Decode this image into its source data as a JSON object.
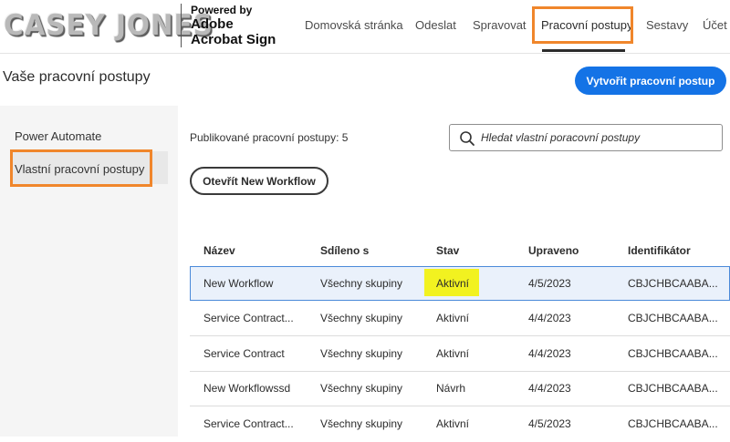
{
  "header": {
    "logo_text": "CASEY JONES",
    "powered_by": "Powered by",
    "brand_line1": "Adobe",
    "brand_line2": "Acrobat Sign",
    "nav": [
      "Domovská stránka",
      "Odeslat",
      "Spravovat",
      "Pracovní postupy",
      "Sestavy",
      "Účet"
    ],
    "active_nav": "Pracovní postupy"
  },
  "page": {
    "title": "Vaše pracovní postupy",
    "create_label": "Vytvořit pracovní postup"
  },
  "sidebar": {
    "items": [
      {
        "label": "Power Automate"
      },
      {
        "label": "Vlastní pracovní postupy"
      }
    ],
    "selected": "Vlastní pracovní postupy"
  },
  "main": {
    "count_label": "Publikované pracovní postupy: 5",
    "search_placeholder": "Hledat vlastní poracovní postupy",
    "open_button": "Otevřít New Workflow"
  },
  "table": {
    "columns": [
      "Název",
      "Sdíleno s",
      "Stav",
      "Upraveno",
      "Identifikátor"
    ],
    "rows": [
      {
        "name": "New Workflow",
        "shared": "Všechny skupiny",
        "status": "Aktivní",
        "modified": "4/5/2023",
        "id": "CBJCHBCAABA..."
      },
      {
        "name": "Service Contract...",
        "shared": "Všechny skupiny",
        "status": "Aktivní",
        "modified": "4/4/2023",
        "id": "CBJCHBCAABA..."
      },
      {
        "name": "Service Contract",
        "shared": "Všechny skupiny",
        "status": "Aktivní",
        "modified": "4/4/2023",
        "id": "CBJCHBCAABA..."
      },
      {
        "name": "New Workflowssd",
        "shared": "Všechny skupiny",
        "status": "Návrh",
        "modified": "4/4/2023",
        "id": "CBJCHBCAABA..."
      },
      {
        "name": "Service Contract...",
        "shared": "Všechny skupiny",
        "status": "Aktivní",
        "modified": "4/5/2023",
        "id": "CBJCHBCAABA..."
      }
    ]
  },
  "colors": {
    "accent_blue": "#1473e6",
    "highlight_orange": "#f0862b",
    "highlight_yellow": "#f2f220",
    "selected_row_bg": "#eaf1fb"
  }
}
